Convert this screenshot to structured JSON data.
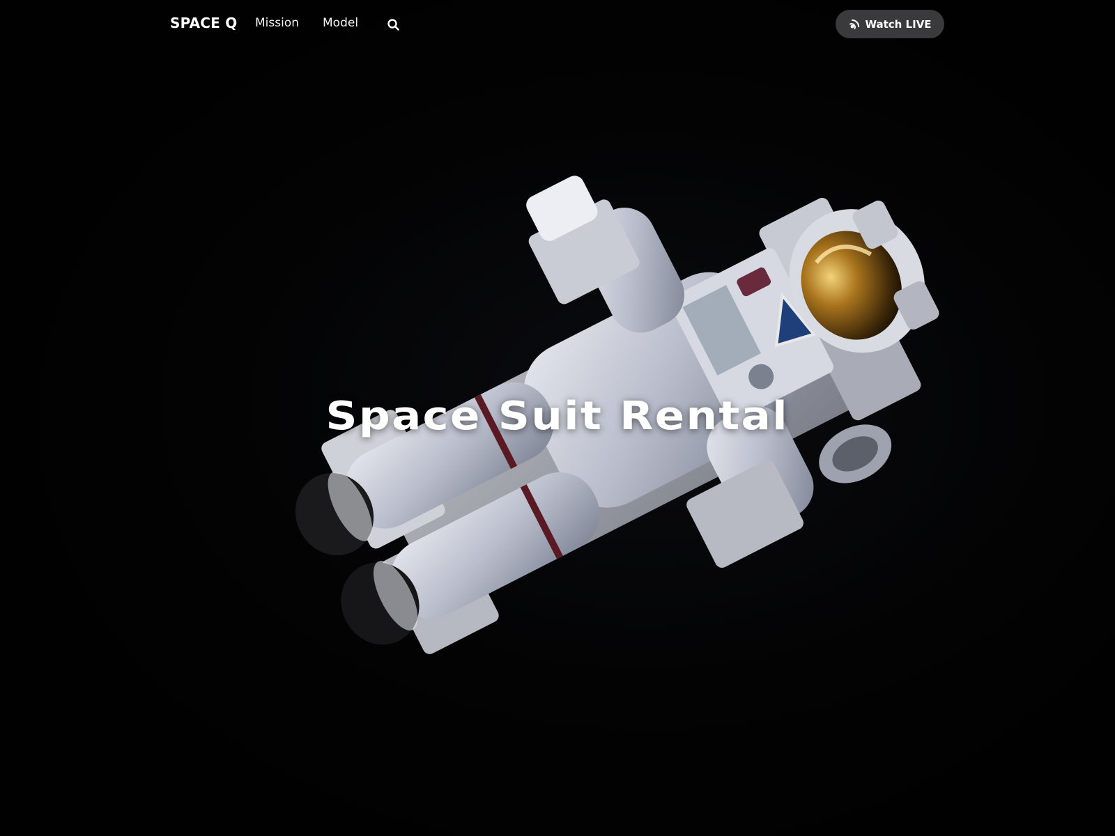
{
  "nav": {
    "brand": "SPACE Q",
    "links": [
      {
        "label": "Mission"
      },
      {
        "label": "Model"
      }
    ],
    "search_icon": "search-icon",
    "live_button": {
      "label": "Watch LIVE",
      "icon": "broadcast-icon"
    }
  },
  "hero": {
    "title": "Space Suit Rental",
    "image": "astronaut-floating-in-space"
  },
  "colors": {
    "background": "#020202",
    "button_background": "#3a3a3c",
    "text": "#ffffff",
    "suit": "#c9ccd6",
    "visor": "#b58a2a"
  }
}
